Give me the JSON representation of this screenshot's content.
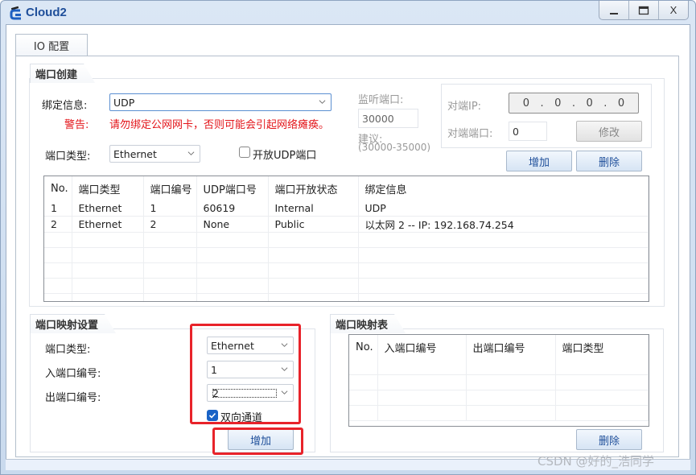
{
  "window": {
    "title": "Cloud2",
    "icon": "cloud-device-icon",
    "controls": {
      "minimize": "minimize-icon",
      "maximize": "maximize-icon",
      "close": "X"
    }
  },
  "tabs": [
    {
      "label": "IO 配置",
      "active": true
    }
  ],
  "port_create": {
    "title": "端口创建",
    "bind_label": "绑定信息:",
    "bind_value": "UDP",
    "warning_label": "警告:",
    "warning_text": "请勿绑定公网网卡，否则可能会引起网络瘫痪。",
    "port_type_label": "端口类型:",
    "port_type_value": "Ethernet",
    "open_udp_label": "开放UDP端口",
    "open_udp_checked": false,
    "listen_port_label": "监听端口:",
    "listen_port_value": "30000",
    "suggest_label": "建议:",
    "suggest_range": "(30000-35000)",
    "peer_ip_label": "对端IP:",
    "peer_ip": [
      "0",
      "0",
      "0",
      "0"
    ],
    "peer_port_label": "对端端口:",
    "peer_port_value": "0",
    "modify_button": "修改",
    "add_button": "增加",
    "delete_button": "删除",
    "table": {
      "columns": [
        "No.",
        "端口类型",
        "端口编号",
        "UDP端口号",
        "端口开放状态",
        "绑定信息"
      ],
      "rows": [
        [
          "1",
          "Ethernet",
          "1",
          "60619",
          "Internal",
          "UDP"
        ],
        [
          "2",
          "Ethernet",
          "2",
          "None",
          "Public",
          "以太网 2 -- IP: 192.168.74.254"
        ]
      ]
    }
  },
  "mapping_settings": {
    "title": "端口映射设置",
    "port_type_label": "端口类型:",
    "port_type_value": "Ethernet",
    "in_port_label": "入端口编号:",
    "in_port_value": "1",
    "out_port_label": "出端口编号:",
    "out_port_value": "2",
    "bidirectional_label": "双向通道",
    "bidirectional_checked": true,
    "add_button": "增加"
  },
  "mapping_table": {
    "title": "端口映射表",
    "columns": [
      "No.",
      "入端口编号",
      "出端口编号",
      "端口类型"
    ],
    "rows": [],
    "delete_button": "删除"
  },
  "watermark": "CSDN @好的_浩同学",
  "colors": {
    "accent": "#1f4f9a",
    "warning": "#e3151a",
    "highlight": "#e8232a",
    "checkbox": "#1a63c6"
  }
}
